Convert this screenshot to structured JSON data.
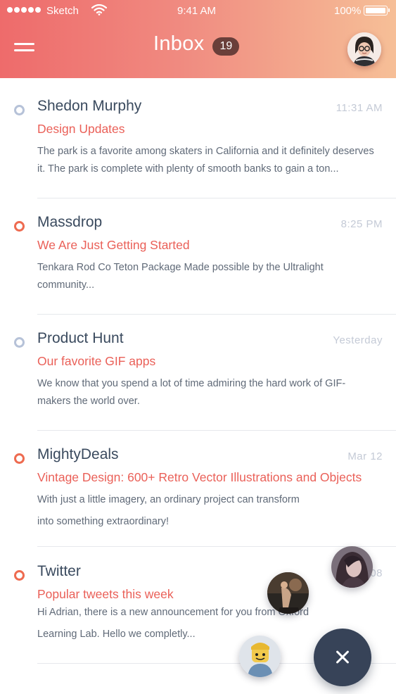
{
  "status_bar": {
    "carrier": "Sketch",
    "time": "9:41 AM",
    "battery": "100%"
  },
  "header": {
    "title": "Inbox",
    "unread_count": "19"
  },
  "emails": [
    {
      "sender": "Shedon Murphy",
      "time": "11:31  AM",
      "subject": "Design Updates",
      "preview": "The park is a favorite among skaters in California and it definitely deserves it. The park is complete with plenty of smooth banks to gain a ton...",
      "unread": false
    },
    {
      "sender": "Massdrop",
      "time": "8:25  PM",
      "subject": "We Are Just Getting Started",
      "preview": "Tenkara Rod Co Teton Package Made possible by the Ultralight community...",
      "unread": true
    },
    {
      "sender": "Product Hunt",
      "time": "Yesterday",
      "subject": "Our favorite GIF apps",
      "preview": "We know that you spend a lot of time admiring the hard work of GIF-makers the world over.",
      "unread": false
    },
    {
      "sender": "MightyDeals",
      "time": "Mar 12",
      "subject": "Vintage Design: 600+ Retro Vector Illustrations and Objects",
      "preview_line1": "With just a little imagery, an ordinary project can transform",
      "preview_line2": "into something extraordinary!",
      "unread": true
    },
    {
      "sender": "Twitter",
      "time": "Mar 08",
      "subject": "Popular tweets this week",
      "preview_line1": "Hi Adrian, there is a new announcement for you from Oxford",
      "preview_line2": "Learning  Lab. Hello we completly...",
      "unread": true
    }
  ],
  "icons": {
    "menu": "hamburger-icon",
    "wifi": "wifi-icon",
    "close": "close-icon"
  },
  "colors": {
    "header_start": "#ee6b6b",
    "header_end": "#f6bf97",
    "accent": "#ea6058",
    "fab": "#374358"
  }
}
